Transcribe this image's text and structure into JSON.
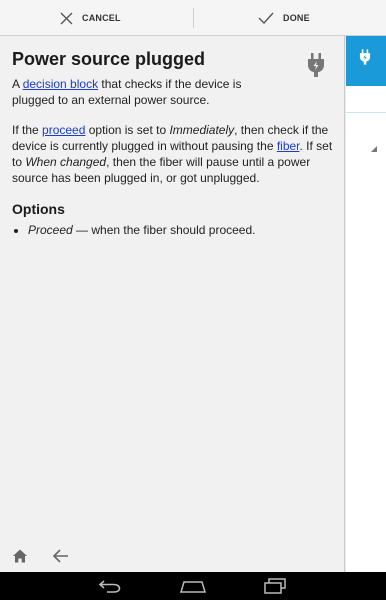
{
  "actionbar": {
    "cancel_label": "CANCEL",
    "done_label": "DONE"
  },
  "doc": {
    "title": "Power source plugged",
    "p1": {
      "t1": "A ",
      "link1": "decision block",
      "t2": " that checks if the device is plugged to an external power source."
    },
    "p2": {
      "t1": "If the ",
      "link1": "proceed",
      "t2": " option is set to ",
      "em1": "Immediately",
      "t3": ", then check if the device is currently plugged in without pausing the ",
      "link2": "fiber",
      "t4": ". If set to ",
      "em2": "When changed",
      "t5": ", then the fiber will pause until a power source has been plugged in, or got unplugged."
    },
    "options_heading": "Options",
    "options": [
      {
        "name": "Proceed",
        "desc": " — when the fiber should proceed."
      }
    ]
  },
  "icons": {
    "cancel": "close-icon",
    "done": "check-icon",
    "plug": "power-plug-icon",
    "home": "home-icon",
    "back": "back-arrow-icon",
    "nav_back": "nav-back-icon",
    "nav_home": "nav-home-icon",
    "nav_recents": "nav-recents-icon"
  },
  "colors": {
    "accent": "#1a9ad8",
    "link": "#1a3ccf",
    "panel_bg": "#f1f1f1"
  }
}
